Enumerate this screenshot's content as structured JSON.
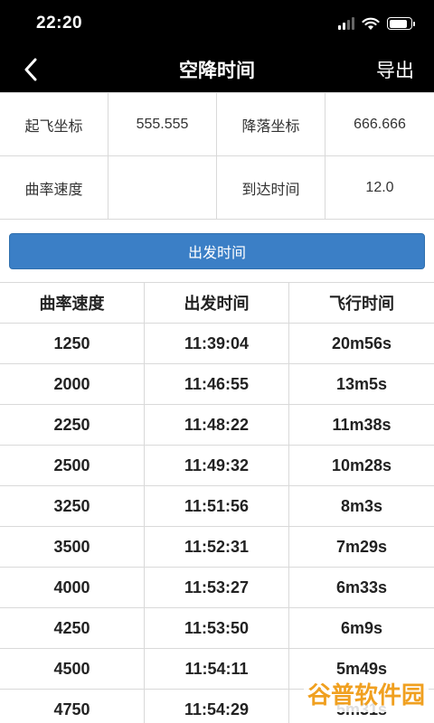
{
  "status_bar": {
    "time": "22:20",
    "battery_level": 0.85
  },
  "nav": {
    "title": "空降时间",
    "export_label": "导出",
    "back_icon": "chevron-left-icon"
  },
  "info": {
    "takeoff_label": "起飞坐标",
    "takeoff_value": "555.555",
    "landing_label": "降落坐标",
    "landing_value": "666.666",
    "curve_speed_label": "曲率速度",
    "curve_speed_value": "",
    "arrival_label": "到达时间",
    "arrival_value": "12.0"
  },
  "depart_button": {
    "label": "出发时间"
  },
  "table": {
    "headers": [
      "曲率速度",
      "出发时间",
      "飞行时间"
    ],
    "rows": [
      [
        "1250",
        "11:39:04",
        "20m56s"
      ],
      [
        "2000",
        "11:46:55",
        "13m5s"
      ],
      [
        "2250",
        "11:48:22",
        "11m38s"
      ],
      [
        "2500",
        "11:49:32",
        "10m28s"
      ],
      [
        "3250",
        "11:51:56",
        "8m3s"
      ],
      [
        "3500",
        "11:52:31",
        "7m29s"
      ],
      [
        "4000",
        "11:53:27",
        "6m33s"
      ],
      [
        "4250",
        "11:53:50",
        "6m9s"
      ],
      [
        "4500",
        "11:54:11",
        "5m49s"
      ],
      [
        "4750",
        "11:54:29",
        "5m31s"
      ]
    ]
  },
  "watermark": {
    "text": "谷普软件园"
  }
}
